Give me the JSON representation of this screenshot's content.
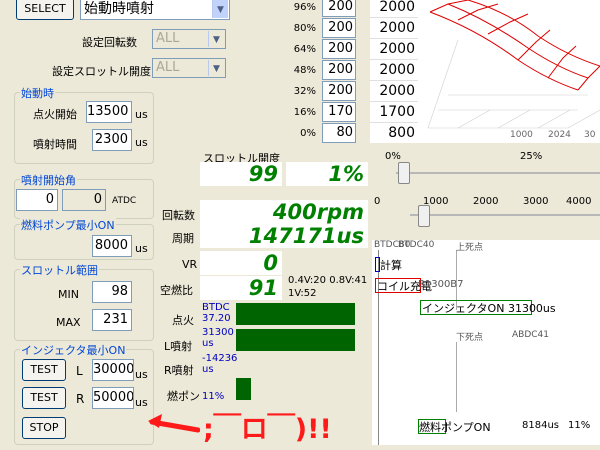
{
  "top": {
    "select_label": "SELECT",
    "mode_value": "始動時噴射"
  },
  "settings": {
    "rpm_label": "設定回転数",
    "rpm_value": "ALL",
    "throttle_label": "設定スロットル開度",
    "throttle_value": "ALL"
  },
  "startup": {
    "title": "始動時",
    "ign_label": "点火開始",
    "ign_value": "13500",
    "inj_label": "噴射時間",
    "inj_value": "2300",
    "unit": "us"
  },
  "inj_start": {
    "title": "噴射開始角",
    "value": "0",
    "value2": "0",
    "unit": "ATDC"
  },
  "pump": {
    "title": "燃料ポンプ最小ON",
    "value": "8000",
    "unit": "us"
  },
  "throttle_range": {
    "title": "スロットル範囲",
    "min_label": "MIN",
    "min_value": "98",
    "max_label": "MAX",
    "max_value": "231"
  },
  "injector": {
    "title": "インジェクタ最小ON",
    "test1": "TEST",
    "l_label": "L",
    "l_value": "30000",
    "test2": "TEST",
    "r_label": "R",
    "r_value": "50000",
    "unit": "us",
    "stop": "STOP"
  },
  "annotation": ";￣ロ￣)!!",
  "table": {
    "pcts": [
      "96%",
      "80%",
      "64%",
      "48%",
      "32%",
      "16%",
      "0%"
    ],
    "col1": [
      "200",
      "200",
      "200",
      "200",
      "200",
      "170",
      "80"
    ],
    "col2": [
      "2000",
      "2000",
      "2000",
      "2000",
      "2000",
      "1700",
      "800"
    ]
  },
  "graph3d": {
    "ticks": [
      "1000",
      "2024",
      "30"
    ]
  },
  "monitor": {
    "throttle_label": "スロットル開度",
    "throttle_val1": "99",
    "throttle_val2": "1%",
    "rpm_label": "回転数",
    "rpm_value": "400rpm",
    "period_label": "周期",
    "period_value": "147171us",
    "vr_label": "VR",
    "vr_value": "0",
    "afr_label": "空燃比",
    "afr_value": "91",
    "voltage": "0.4V:20 0.8V:41 1V:52",
    "ign_label": "点火",
    "ign_text": "BTDC 37.20",
    "ign_bar": 0.86,
    "linj_label": "L噴射",
    "linj_text": "31300 us",
    "linj_bar": 0.86,
    "rinj_label": "R噴射",
    "rinj_text": "-14236 us",
    "pump_label": "燃ポン",
    "pump_text": "11%",
    "pump_bar": 0.11
  },
  "slider1": {
    "labels": [
      "0%",
      "25%"
    ],
    "value": 0.01
  },
  "slider2": {
    "labels": [
      "0",
      "1000",
      "2000",
      "3000",
      "4000"
    ],
    "value": 0.04
  },
  "timing": {
    "btdc_a": "BTDC80",
    "btdc_b": "BTDC40",
    "top_dead": "上死点",
    "calc": "計算",
    "ign_box": "コイル充電",
    "ign_box_tail": "B1300B7",
    "inj_box": "インジェクタON 31300us",
    "bottom_dead": "下死点",
    "abdc": "ABDC41",
    "pump_box": "燃料ポンプON",
    "pump_text": "8184us",
    "pump_pct": "11%"
  }
}
